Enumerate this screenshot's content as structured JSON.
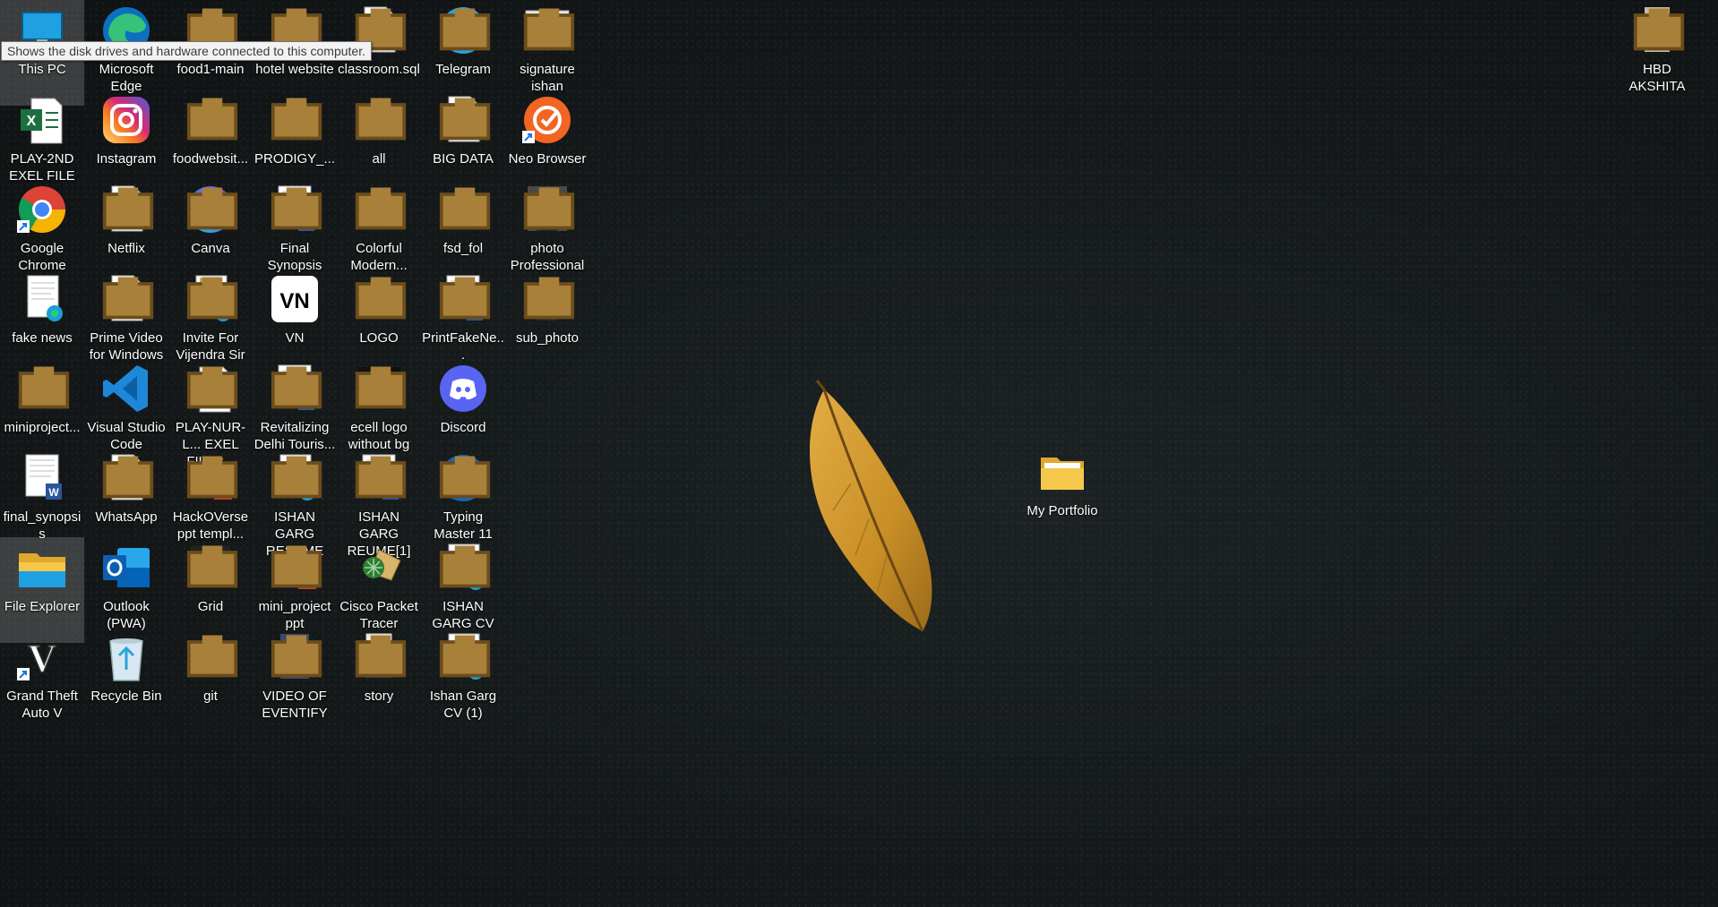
{
  "tooltip": "Shows the disk drives and hardware connected to this computer.",
  "icons": {
    "this_pc": "This PC",
    "edge": "Microsoft Edge",
    "food1": "food1-main",
    "hotel": "hotel website",
    "classroom": "classroom.sql",
    "telegram": "Telegram",
    "signature": "signature ishan",
    "hbd": "HBD AKSHITA",
    "play2nd": "PLAY-2ND EXEL FILE",
    "instagram": "Instagram",
    "foodweb": "foodwebsit...",
    "prodigy": "PRODIGY_...",
    "all": "all",
    "bigdata": "BIG DATA",
    "neo": "Neo Browser",
    "chrome": "Google Chrome",
    "netflix": "Netflix",
    "canva": "Canva",
    "final_syn": "Final Synopsis",
    "colorful": "Colorful Modern...",
    "fsd": "fsd_fol",
    "photo_prof": "photo Professional",
    "fake_news": "fake news",
    "prime": "Prime Video for Windows",
    "invite": "Invite For Vijendra Sir",
    "vn": "VN",
    "logo": "LOGO",
    "printfake": "PrintFakeNe...",
    "sub_photo": "sub_photo",
    "miniproject": "miniproject...",
    "vscode": "Visual Studio Code",
    "playnur": "PLAY-NUR-L... EXEL FILE-t...",
    "revitalizing": "Revitalizing Delhi Touris...",
    "ecell": "ecell logo without bg",
    "discord": "Discord",
    "final_synopsis2": "final_synopsis",
    "whatsapp": "WhatsApp",
    "hackoverse": "HackOVerse ppt templ...",
    "resume": "ISHAN GARG RESUME",
    "reume1": "ISHAN GARG REUME[1]",
    "typing": "Typing Master 11",
    "explorer": "File Explorer",
    "outlook": "Outlook (PWA)",
    "grid": "Grid",
    "mini_ppt": "mini_project ppt",
    "cisco": "Cisco Packet Tracer",
    "cv": "ISHAN GARG CV",
    "gta": "Grand Theft Auto V",
    "recycle": "Recycle Bin",
    "git": "git",
    "video": "VIDEO OF EVENTIFY",
    "story": "story",
    "cv1": "Ishan Garg CV (1)",
    "portfolio": "My Portfolio"
  },
  "colors": {
    "folder": "#f5c84c",
    "folder_dark": "#e0a82e",
    "word": "#2b579a",
    "excel": "#1d6f42",
    "powerpoint": "#c43e1c",
    "telegram": "#2aa3df",
    "discord": "#5865f2",
    "vscode": "#1e88d8",
    "leaf": "#c9922a"
  }
}
